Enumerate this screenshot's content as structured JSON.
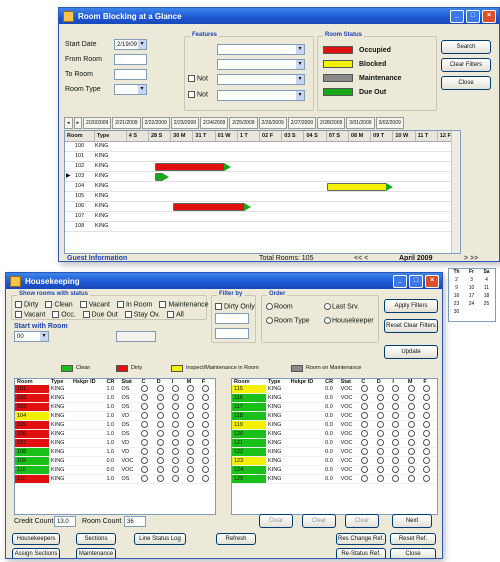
{
  "room_blocking": {
    "title": "Room Blocking at a Glance",
    "filters": {
      "start_date_label": "Start Date",
      "start_date_value": "2/19/09",
      "from_room_label": "From Room",
      "to_room_label": "To Room",
      "room_type_label": "Room Type",
      "features_title": "Features",
      "not_label": "Not"
    },
    "room_status": {
      "title": "Room Status",
      "legend": [
        {
          "label": "Occupied",
          "color": "#e01010"
        },
        {
          "label": "Blocked",
          "color": "#f4f000"
        },
        {
          "label": "Maintenance",
          "color": "#8a8a8a"
        },
        {
          "label": "Due Out",
          "color": "#18a818"
        }
      ]
    },
    "buttons": {
      "search": "Search",
      "clear_filters": "Clear Filters",
      "close": "Close"
    },
    "date_tabs": [
      "2/20/2009",
      "2/21/2009",
      "2/22/2009",
      "2/23/2009",
      "2/24/2009",
      "2/25/2009",
      "2/26/2009",
      "2/27/2009",
      "2/28/2009",
      "3/01/2009",
      "3/02/2009"
    ],
    "grid_headers": [
      "Room",
      "Type",
      "4 S",
      "28 S",
      "30 M",
      "31 T",
      "01 W",
      "1 T",
      "02 F",
      "03 S",
      "04 S",
      "07 S",
      "08 M",
      "09 T",
      "10 W",
      "11 T",
      "12 F"
    ],
    "rows": [
      {
        "room": "100",
        "type": "KING"
      },
      {
        "room": "101",
        "type": "KING"
      },
      {
        "room": "102",
        "type": "KING"
      },
      {
        "room": "103",
        "type": "KING"
      },
      {
        "room": "104",
        "type": "KING"
      },
      {
        "room": "105",
        "type": "KING"
      },
      {
        "room": "106",
        "type": "KING"
      },
      {
        "room": "107",
        "type": "KING"
      },
      {
        "room": "108",
        "type": "KING"
      }
    ],
    "footer": {
      "guest_info_label": "Guest Information",
      "total_rooms": "Total Rooms: 105",
      "nav": "<<  <",
      "month_label": "April 2009",
      "nav_right": ">  >>"
    },
    "calendar_numbers": [
      [
        "Th",
        "Fr",
        "Sa"
      ],
      [
        "2",
        "3",
        "4"
      ],
      [
        "9",
        "10",
        "11"
      ],
      [
        "16",
        "17",
        "18"
      ],
      [
        "23",
        "24",
        "25"
      ],
      [
        "30",
        "",
        ""
      ]
    ]
  },
  "housekeeping": {
    "title": "Housekeeping",
    "filters": {
      "show_rooms_title": "Show rooms with status",
      "status_row1": [
        "Dirty",
        "Clean",
        "Vacant",
        "In Room",
        "Maintenance"
      ],
      "status_row2": [
        "Vacant",
        "Occ.",
        "Due Out",
        "Stay Ov.",
        "All"
      ],
      "start_room_label": "Start with Room",
      "start_room_value": "00",
      "filter_by_title": "Filter by",
      "filter_option": "Dirty Only",
      "order_title": "Order",
      "order_options": [
        "Room",
        "Last Srv.",
        "Room Type",
        "Housekeeper"
      ]
    },
    "buttons": {
      "apply_filters": "Apply Filters",
      "reset_filters": "Reset Clear Filters",
      "update": "Update",
      "clear1": "Clear",
      "clear2": "Clear",
      "clear3": "Clear",
      "next": "Next"
    },
    "legend": [
      {
        "label": "Clean",
        "color": "#18c018"
      },
      {
        "label": "Dirty",
        "color": "#e01010"
      },
      {
        "label": "Inspect/Maintenance in Room",
        "color": "#f4f000"
      },
      {
        "label": "Room on Maintenance",
        "color": "#8a8a8a"
      }
    ],
    "col_headers": [
      "Room",
      "Type",
      "Hskpr ID",
      "CR",
      "Stat",
      "C",
      "D",
      "I",
      "M",
      "F"
    ],
    "left_rows": [
      {
        "room": "101",
        "type": "KING",
        "cr": "1.0",
        "stat": "OS",
        "color": "#e01010"
      },
      {
        "room": "102",
        "type": "KING",
        "cr": "1.0",
        "stat": "OS",
        "color": "#e01010"
      },
      {
        "room": "103",
        "type": "KING",
        "cr": "1.0",
        "stat": "OS",
        "color": "#e01010"
      },
      {
        "room": "104",
        "type": "KING",
        "cr": "1.0",
        "stat": "VD",
        "color": "#f4f000"
      },
      {
        "room": "105",
        "type": "KING",
        "cr": "1.0",
        "stat": "OS",
        "color": "#e01010"
      },
      {
        "room": "106",
        "type": "KING",
        "cr": "1.0",
        "stat": "OS",
        "color": "#e01010"
      },
      {
        "room": "107",
        "type": "KING",
        "cr": "1.0",
        "stat": "VD",
        "color": "#e01010"
      },
      {
        "room": "108",
        "type": "KING",
        "cr": "1.0",
        "stat": "VD",
        "color": "#18c018"
      },
      {
        "room": "109",
        "type": "KING",
        "cr": "0.0",
        "stat": "VOC",
        "color": "#18c018"
      },
      {
        "room": "110",
        "type": "KING",
        "cr": "0.0",
        "stat": "VOC",
        "color": "#18c018"
      },
      {
        "room": "111",
        "type": "KING",
        "cr": "1.0",
        "stat": "OS",
        "color": "#e01010"
      }
    ],
    "right_rows": [
      {
        "room": "115",
        "type": "KING",
        "cr": "0.0",
        "stat": "VOC",
        "color": "#f4f000"
      },
      {
        "room": "116",
        "type": "KING",
        "cr": "0.0",
        "stat": "VOC",
        "color": "#18c018"
      },
      {
        "room": "117",
        "type": "KING",
        "cr": "0.0",
        "stat": "VOC",
        "color": "#18c018"
      },
      {
        "room": "118",
        "type": "KING",
        "cr": "0.0",
        "stat": "VOC",
        "color": "#18c018"
      },
      {
        "room": "119",
        "type": "KING",
        "cr": "0.0",
        "stat": "VOC",
        "color": "#f4f000"
      },
      {
        "room": "120",
        "type": "KING",
        "cr": "0.0",
        "stat": "VOC",
        "color": "#18c018"
      },
      {
        "room": "121",
        "type": "KING",
        "cr": "0.0",
        "stat": "VOC",
        "color": "#18c018"
      },
      {
        "room": "122",
        "type": "KING",
        "cr": "0.0",
        "stat": "VOC",
        "color": "#18c018"
      },
      {
        "room": "123",
        "type": "KING",
        "cr": "0.0",
        "stat": "VOC",
        "color": "#f4f000"
      },
      {
        "room": "124",
        "type": "KING",
        "cr": "0.0",
        "stat": "VOC",
        "color": "#18c018"
      },
      {
        "room": "125",
        "type": "KING",
        "cr": "0.0",
        "stat": "VOC",
        "color": "#18c018"
      }
    ],
    "credit_label": "Credit Count",
    "credit_value": "13.0",
    "room_count_label": "Room Count",
    "room_count_value": "36",
    "bottom_buttons": [
      "Housekeepers",
      "Sections",
      "Line Status Log",
      "Refresh",
      "Res Change Ref.",
      "Reset Ref.",
      "Assign Sections",
      "Maintenance",
      "Re-Status Ref.",
      "Close"
    ]
  }
}
